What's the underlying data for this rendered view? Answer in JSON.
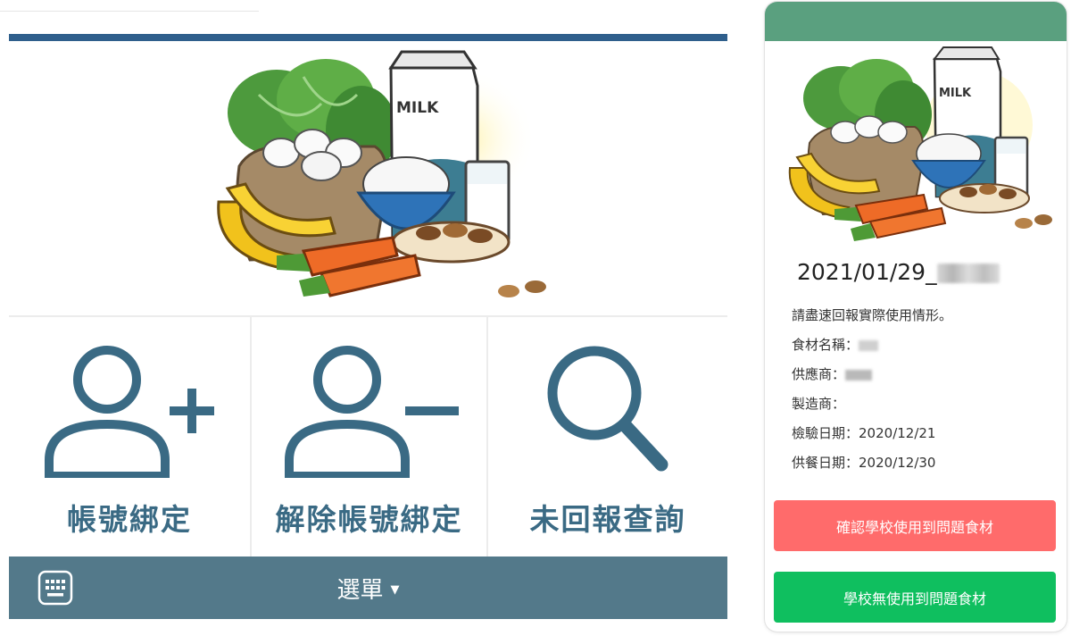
{
  "menu": {
    "items": [
      {
        "label": "帳號綁定",
        "icon": "add-user-icon"
      },
      {
        "label": "解除帳號綁定",
        "icon": "remove-user-icon"
      },
      {
        "label": "未回報查詢",
        "icon": "search-icon"
      }
    ],
    "bar_label": "選單",
    "bar_icon": "keyboard-icon",
    "caret_icon": "caret-down-icon"
  },
  "card": {
    "title": "2021/01/29_",
    "instruction": "請盡速回報實際使用情形。",
    "fields": [
      {
        "label": "食材名稱：",
        "value": ""
      },
      {
        "label": "供應商：",
        "value": ""
      },
      {
        "label": "製造商：",
        "value": ""
      },
      {
        "label": "檢驗日期：",
        "value": "2020/12/21"
      },
      {
        "label": "供餐日期：",
        "value": "2020/12/30"
      }
    ],
    "confirm_button": "確認學校使用到問題食材",
    "deny_button": "學校無使用到問題食材"
  },
  "colors": {
    "banner_bar": "#2f5f8c",
    "icon_color": "#3a6a84",
    "menu_bar": "#53798a",
    "card_header": "#5aa07f",
    "confirm_button": "#ff6b6b",
    "deny_button": "#0fbf5f"
  },
  "illustration": {
    "carton_text": "MILK",
    "description_icon": "food-illustration"
  }
}
